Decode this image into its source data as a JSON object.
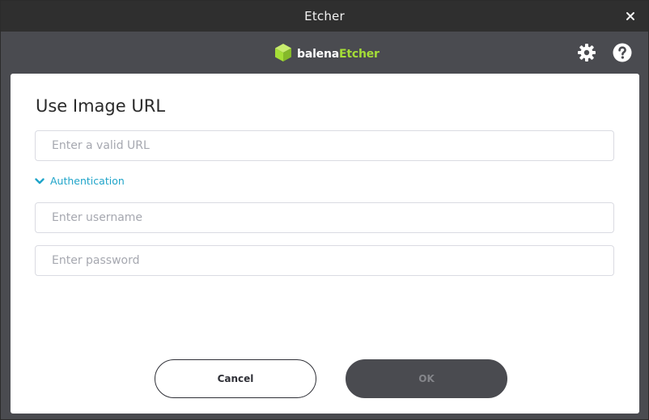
{
  "window": {
    "title": "Etcher"
  },
  "header": {
    "brand_part1": "balena",
    "brand_part2": "Etcher",
    "brand_accent_color": "#a5de37",
    "settings_icon": "gear-icon",
    "help_icon": "help-icon"
  },
  "dialog": {
    "title": "Use Image URL",
    "url_placeholder": "Enter a valid URL",
    "auth_label": "Authentication",
    "username_placeholder": "Enter username",
    "password_placeholder": "Enter password",
    "cancel_label": "Cancel",
    "ok_label": "OK",
    "link_color": "#1fa4c9"
  }
}
